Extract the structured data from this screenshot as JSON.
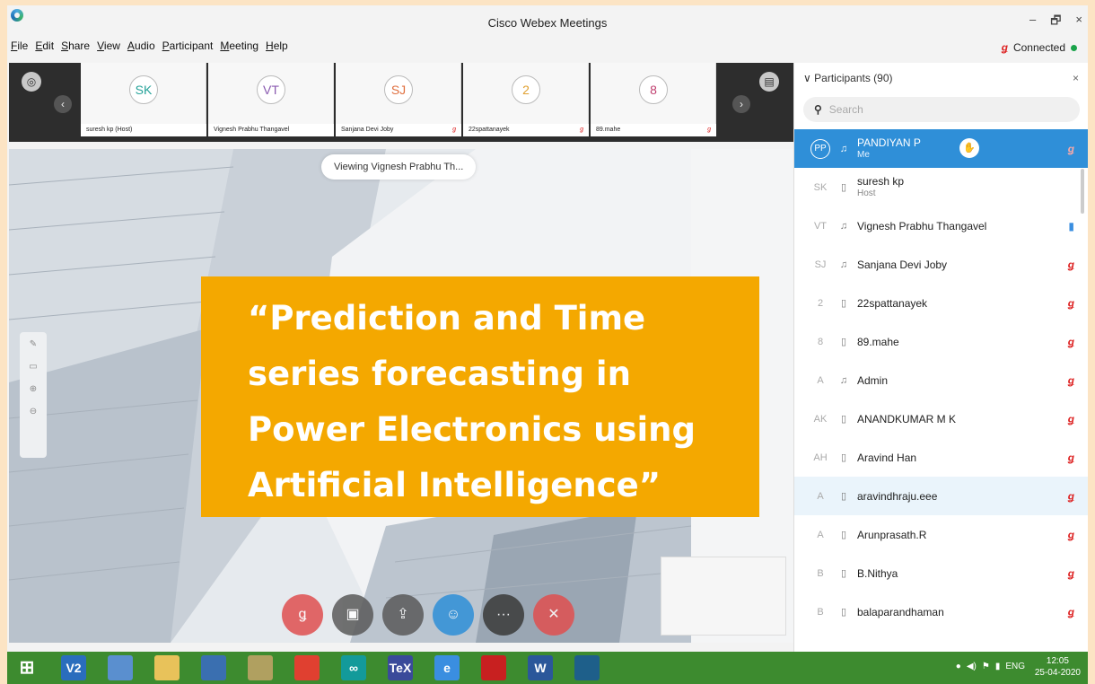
{
  "window": {
    "title": "Cisco Webex Meetings",
    "controls": [
      "–",
      "🗗",
      "×"
    ],
    "menu": [
      "File",
      "Edit",
      "Share",
      "View",
      "Audio",
      "Participant",
      "Meeting",
      "Help"
    ],
    "status": "Connected"
  },
  "strip": {
    "thumbnails": [
      {
        "initials": "SK",
        "name": "suresh kp (Host)"
      },
      {
        "initials": "VT",
        "name": "Vignesh Prabhu Thangavel"
      },
      {
        "initials": "SJ",
        "name": "Sanjana Devi Joby"
      },
      {
        "initials": "2",
        "name": "22spattanayek"
      },
      {
        "initials": "8",
        "name": "89.mahe"
      }
    ]
  },
  "stage": {
    "viewing_label": "Viewing Vignesh Prabhu Th...",
    "slide_lines": [
      "“Prediction and Time",
      "series forecasting in",
      "Power Electronics using",
      "Artificial Intelligence”"
    ],
    "controls": [
      {
        "icon": "mute-icon",
        "color": "#e05050"
      },
      {
        "icon": "video-icon",
        "color": "#5a5a5a"
      },
      {
        "icon": "share-icon",
        "color": "#5a5a5a"
      },
      {
        "icon": "participants-icon",
        "color": "#2f8fd8"
      },
      {
        "icon": "more-icon",
        "color": "#3a3a3a"
      },
      {
        "icon": "leave-icon",
        "color": "#e05050"
      }
    ]
  },
  "panel": {
    "title": "Participants (90)",
    "search_placeholder": "Search",
    "participants": [
      {
        "initials": "PP",
        "name": "PANDIYAN P",
        "sub": "Me",
        "device": "headset",
        "mic": "muted"
      },
      {
        "initials": "SK",
        "name": "suresh kp",
        "sub": "Host",
        "device": "phone",
        "mic": "none"
      },
      {
        "initials": "VT",
        "name": "Vignesh Prabhu Thangavel",
        "sub": "",
        "device": "headset",
        "mic": "speaking"
      },
      {
        "initials": "SJ",
        "name": " Sanjana Devi Joby",
        "sub": "",
        "device": "headset",
        "mic": "muted"
      },
      {
        "initials": "2",
        "name": "22spattanayek",
        "sub": "",
        "device": "phone",
        "mic": "muted"
      },
      {
        "initials": "8",
        "name": "89.mahe",
        "sub": "",
        "device": "phone",
        "mic": "muted"
      },
      {
        "initials": "A",
        "name": "Admin",
        "sub": "",
        "device": "headset",
        "mic": "muted"
      },
      {
        "initials": "AK",
        "name": "ANANDKUMAR M K",
        "sub": "",
        "device": "phone",
        "mic": "muted"
      },
      {
        "initials": "AH",
        "name": "Aravind Han",
        "sub": "",
        "device": "phone",
        "mic": "muted"
      },
      {
        "initials": "A",
        "name": "aravindhraju.eee",
        "sub": "",
        "device": "phone",
        "mic": "muted"
      },
      {
        "initials": "A",
        "name": "Arunprasath.R",
        "sub": "",
        "device": "phone",
        "mic": "muted"
      },
      {
        "initials": "B",
        "name": "B.Nithya",
        "sub": "",
        "device": "phone",
        "mic": "muted"
      },
      {
        "initials": "B",
        "name": "balaparandhaman",
        "sub": "",
        "device": "phone",
        "mic": "muted"
      }
    ]
  },
  "taskbar": {
    "apps": [
      {
        "name": "start-icon",
        "label": "",
        "color": "#3d8b2f"
      },
      {
        "name": "vs-icon",
        "label": "V2",
        "color": "#2a6dbd"
      },
      {
        "name": "paint-icon",
        "label": "",
        "color": "#5a8fcf"
      },
      {
        "name": "folder-icon",
        "label": "",
        "color": "#e8c25a"
      },
      {
        "name": "notes-icon",
        "label": "",
        "color": "#3a6fb0"
      },
      {
        "name": "editor-icon",
        "label": "",
        "color": "#b0a060"
      },
      {
        "name": "chrome-icon",
        "label": "",
        "color": "#e04030"
      },
      {
        "name": "arduino-icon",
        "label": "∞",
        "color": "#139a9a"
      },
      {
        "name": "tex-icon",
        "label": "TeX",
        "color": "#3a4a9a"
      },
      {
        "name": "ie-icon",
        "label": "e",
        "color": "#3a8ee0"
      },
      {
        "name": "acrobat-icon",
        "label": "",
        "color": "#c82020"
      },
      {
        "name": "word-icon",
        "label": "W",
        "color": "#2b579a"
      },
      {
        "name": "webex-icon",
        "label": "",
        "color": "#1e5f8a"
      }
    ],
    "lang": "ENG",
    "time": "12:05",
    "date": "25-04-2020"
  }
}
